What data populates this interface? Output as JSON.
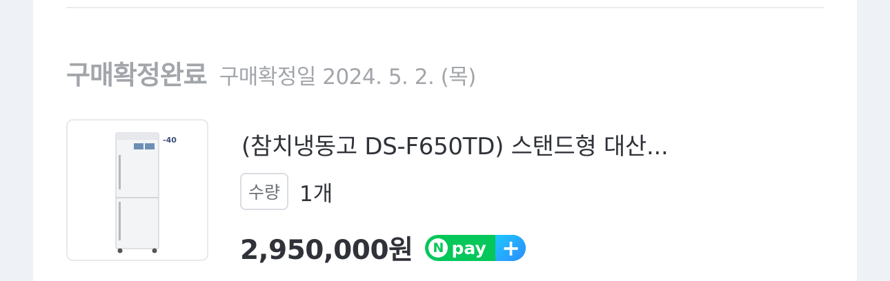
{
  "order": {
    "status_title": "구매확정완료",
    "status_date": "구매확정일 2024. 5. 2. (목)"
  },
  "product": {
    "name": "(참치냉동고 DS-F650TD) 스탠드형 대산...",
    "thumbnail_label": "-40",
    "quantity_label": "수량",
    "quantity_value": "1개",
    "price": "2,950,000원"
  },
  "payment": {
    "badge_n": "N",
    "badge_text": "pay",
    "badge_plus": "+",
    "brand_color": "#05c75a"
  }
}
